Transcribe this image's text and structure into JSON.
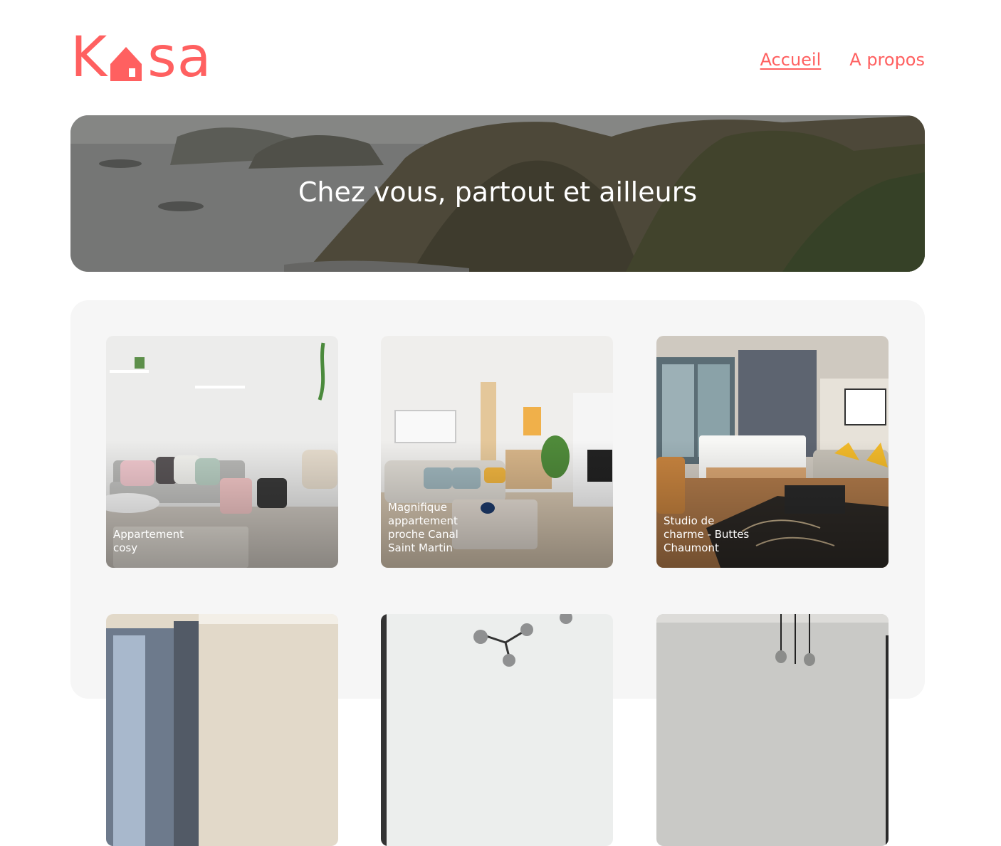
{
  "header": {
    "logo": {
      "text_start": "K",
      "text_end": "sa",
      "brand_color": "#ff6060",
      "icon": "house-icon"
    },
    "nav": [
      {
        "label": "Accueil",
        "active": true
      },
      {
        "label": "A propos",
        "active": false
      }
    ]
  },
  "banner": {
    "title": "Chez vous, partout et ailleurs",
    "image": "coastal-cliffs-photo"
  },
  "gallery": {
    "cards": [
      {
        "title": "Appartement cosy",
        "image": "bright-living-room-photo"
      },
      {
        "title": "Magnifique appartement proche Canal Saint Martin",
        "image": "open-living-room-photo"
      },
      {
        "title": "Studio de charme - Buttes Chaumont",
        "image": "hotel-style-bedroom-photo"
      },
      {
        "title": "",
        "image": "bedroom-window-photo"
      },
      {
        "title": "",
        "image": "pendant-light-photo"
      },
      {
        "title": "",
        "image": "concrete-wall-pendant-photo"
      }
    ]
  }
}
